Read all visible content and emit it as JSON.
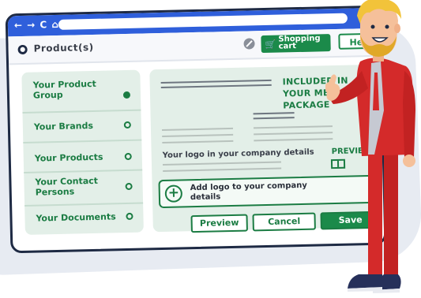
{
  "browser": {
    "nav_icons": "← → C ⌂"
  },
  "header": {
    "title": "Product(s)",
    "cart_label": "Shopping cart",
    "help_label": "Help"
  },
  "sidebar": {
    "items": [
      {
        "label": "Your Product Group",
        "active": true
      },
      {
        "label": "Your Brands",
        "active": false
      },
      {
        "label": "Your Products",
        "active": false
      },
      {
        "label": "Your Contact Persons",
        "active": false
      },
      {
        "label": "Your Documents",
        "active": false
      }
    ]
  },
  "main": {
    "included_text": "INCLUDED IN YOUR MEDIA PACKAGE",
    "logo_text": "Your logo in your company details",
    "preview_text": "PREVIEW",
    "add_logo_label": "Add logo to your company details",
    "buttons": {
      "preview": "Preview",
      "cancel": "Cancel",
      "save": "Save"
    }
  },
  "colors": {
    "accent_green": "#1b8a4a",
    "browser_blue": "#2f5fdb",
    "panel_green": "#e3efe8"
  }
}
